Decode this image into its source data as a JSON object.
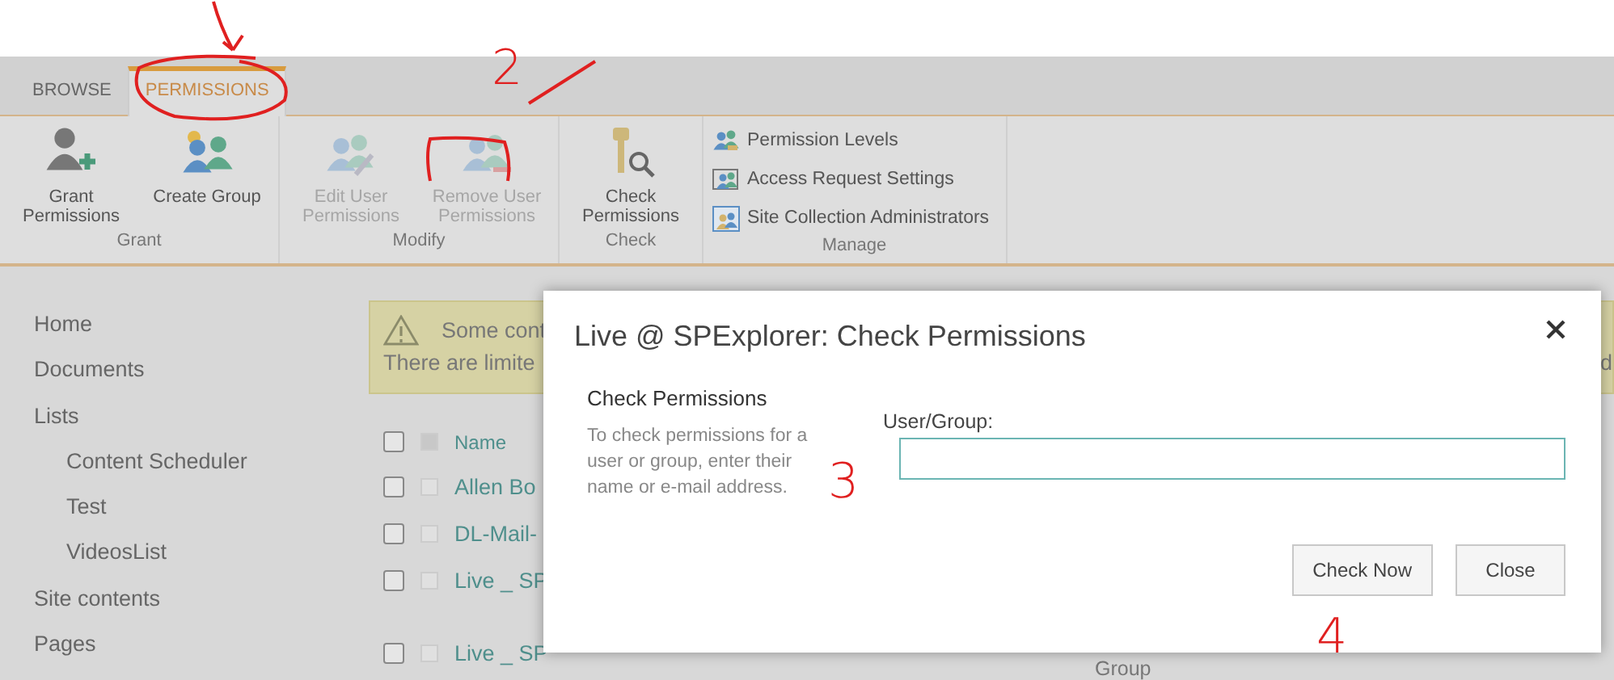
{
  "ribbon": {
    "tabs": [
      {
        "label": "BROWSE",
        "selected": false
      },
      {
        "label": "PERMISSIONS",
        "selected": true
      }
    ],
    "groups": [
      {
        "label": "Grant",
        "buttons": [
          {
            "label": "Grant Permissions",
            "kind": "grant",
            "disabled": false
          },
          {
            "label": "Create Group",
            "kind": "create",
            "disabled": false
          }
        ]
      },
      {
        "label": "Modify",
        "buttons": [
          {
            "label": "Edit User Permissions",
            "kind": "edit",
            "disabled": true
          },
          {
            "label": "Remove User Permissions",
            "kind": "remove",
            "disabled": true
          }
        ]
      },
      {
        "label": "Check",
        "buttons": [
          {
            "label": "Check Permissions",
            "kind": "check",
            "disabled": false
          }
        ]
      },
      {
        "label": "Manage",
        "small_buttons": [
          {
            "label": "Permission Levels",
            "kind": "levels"
          },
          {
            "label": "Access Request Settings",
            "kind": "access"
          },
          {
            "label": "Site Collection Administrators",
            "kind": "admins"
          }
        ]
      }
    ]
  },
  "sidebar": {
    "items": [
      {
        "label": "Home"
      },
      {
        "label": "Documents"
      },
      {
        "label": "Lists",
        "children": [
          {
            "label": "Content Scheduler"
          },
          {
            "label": "Test"
          },
          {
            "label": "VideosList"
          }
        ]
      },
      {
        "label": "Site contents"
      },
      {
        "label": "Pages"
      }
    ]
  },
  "warning": {
    "line_1": "Some cont",
    "line_2": "There are limite",
    "line_2_tail": "d"
  },
  "table": {
    "header": {
      "label": "Name",
      "checked": false
    },
    "rows": [
      {
        "name": "Allen Bo",
        "checked": false
      },
      {
        "name": "DL-Mail-",
        "checked": false
      },
      {
        "name": "Live _ SP",
        "checked": false
      },
      {
        "name": "Live _ SP",
        "checked": false
      }
    ],
    "footer_text": "Group"
  },
  "dialog": {
    "title": "Live @ SPExplorer: Check Permissions",
    "section_title": "Check Permissions",
    "description": "To check permissions for a user or group, enter their name or e-mail address.",
    "field_label": "User/Group:",
    "buttons": [
      "Check Now",
      "Close"
    ]
  },
  "annotations": [
    {
      "kind": "arrow"
    },
    {
      "kind": "circle"
    },
    {
      "kind": "digit",
      "text": "2"
    },
    {
      "kind": "tick"
    },
    {
      "kind": "bracket"
    },
    {
      "kind": "digit",
      "text": "3"
    },
    {
      "kind": "digit",
      "text": "4"
    }
  ]
}
